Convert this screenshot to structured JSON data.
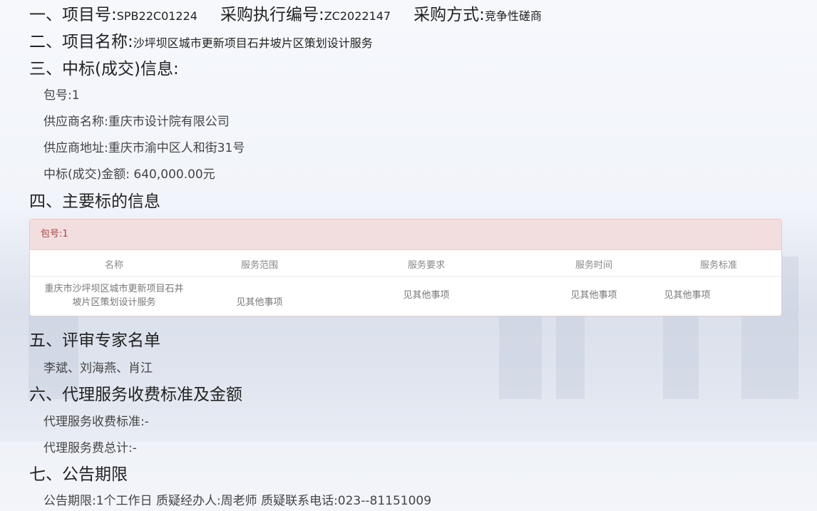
{
  "sections": {
    "s1": {
      "label_project_no": "一、项目号:",
      "project_no": "SPB22C01224",
      "label_exec_no": "采购执行编号:",
      "exec_no": "ZC2022147",
      "label_method": "采购方式:",
      "method": "竞争性磋商"
    },
    "s2": {
      "label": "二、项目名称:",
      "value": "沙坪坝区城市更新项目石井坡片区策划设计服务"
    },
    "s3": {
      "label": "三、中标(成交)信息:",
      "package": "包号:1",
      "supplier_name": "供应商名称:重庆市设计院有限公司",
      "supplier_address": "供应商地址:重庆市渝中区人和街31号",
      "amount": "中标(成交)金额: 640,000.00元"
    },
    "s4": {
      "label": "四、主要标的信息",
      "panel_title": "包号:1",
      "columns": [
        "名称",
        "服务范围",
        "服务要求",
        "服务时间",
        "服务标准"
      ],
      "row": {
        "name_line1": "重庆市沙坪坝区城市更新项目石井",
        "name_line2": "坡片区策划设计服务",
        "scope": "见其他事项",
        "requirement": "见其他事项",
        "time": "见其他事项",
        "standard": "见其他事项"
      }
    },
    "s5": {
      "label": "五、评审专家名单",
      "value": "李斌、刘海燕、肖江"
    },
    "s6": {
      "label": "六、代理服务收费标准及金额",
      "fee_standard": "代理服务收费标准:-",
      "fee_total": "代理服务费总计:-"
    },
    "s7": {
      "label": "七、公告期限",
      "value": "公告期限:1个工作日 质疑经办人:周老师 质疑联系电话:023--81151009"
    }
  },
  "colors": {
    "heading": "#222222",
    "body_text": "#444444",
    "panel_head_bg": "#f2dede",
    "panel_head_text": "#a94442",
    "panel_border": "#e7c9cb"
  }
}
